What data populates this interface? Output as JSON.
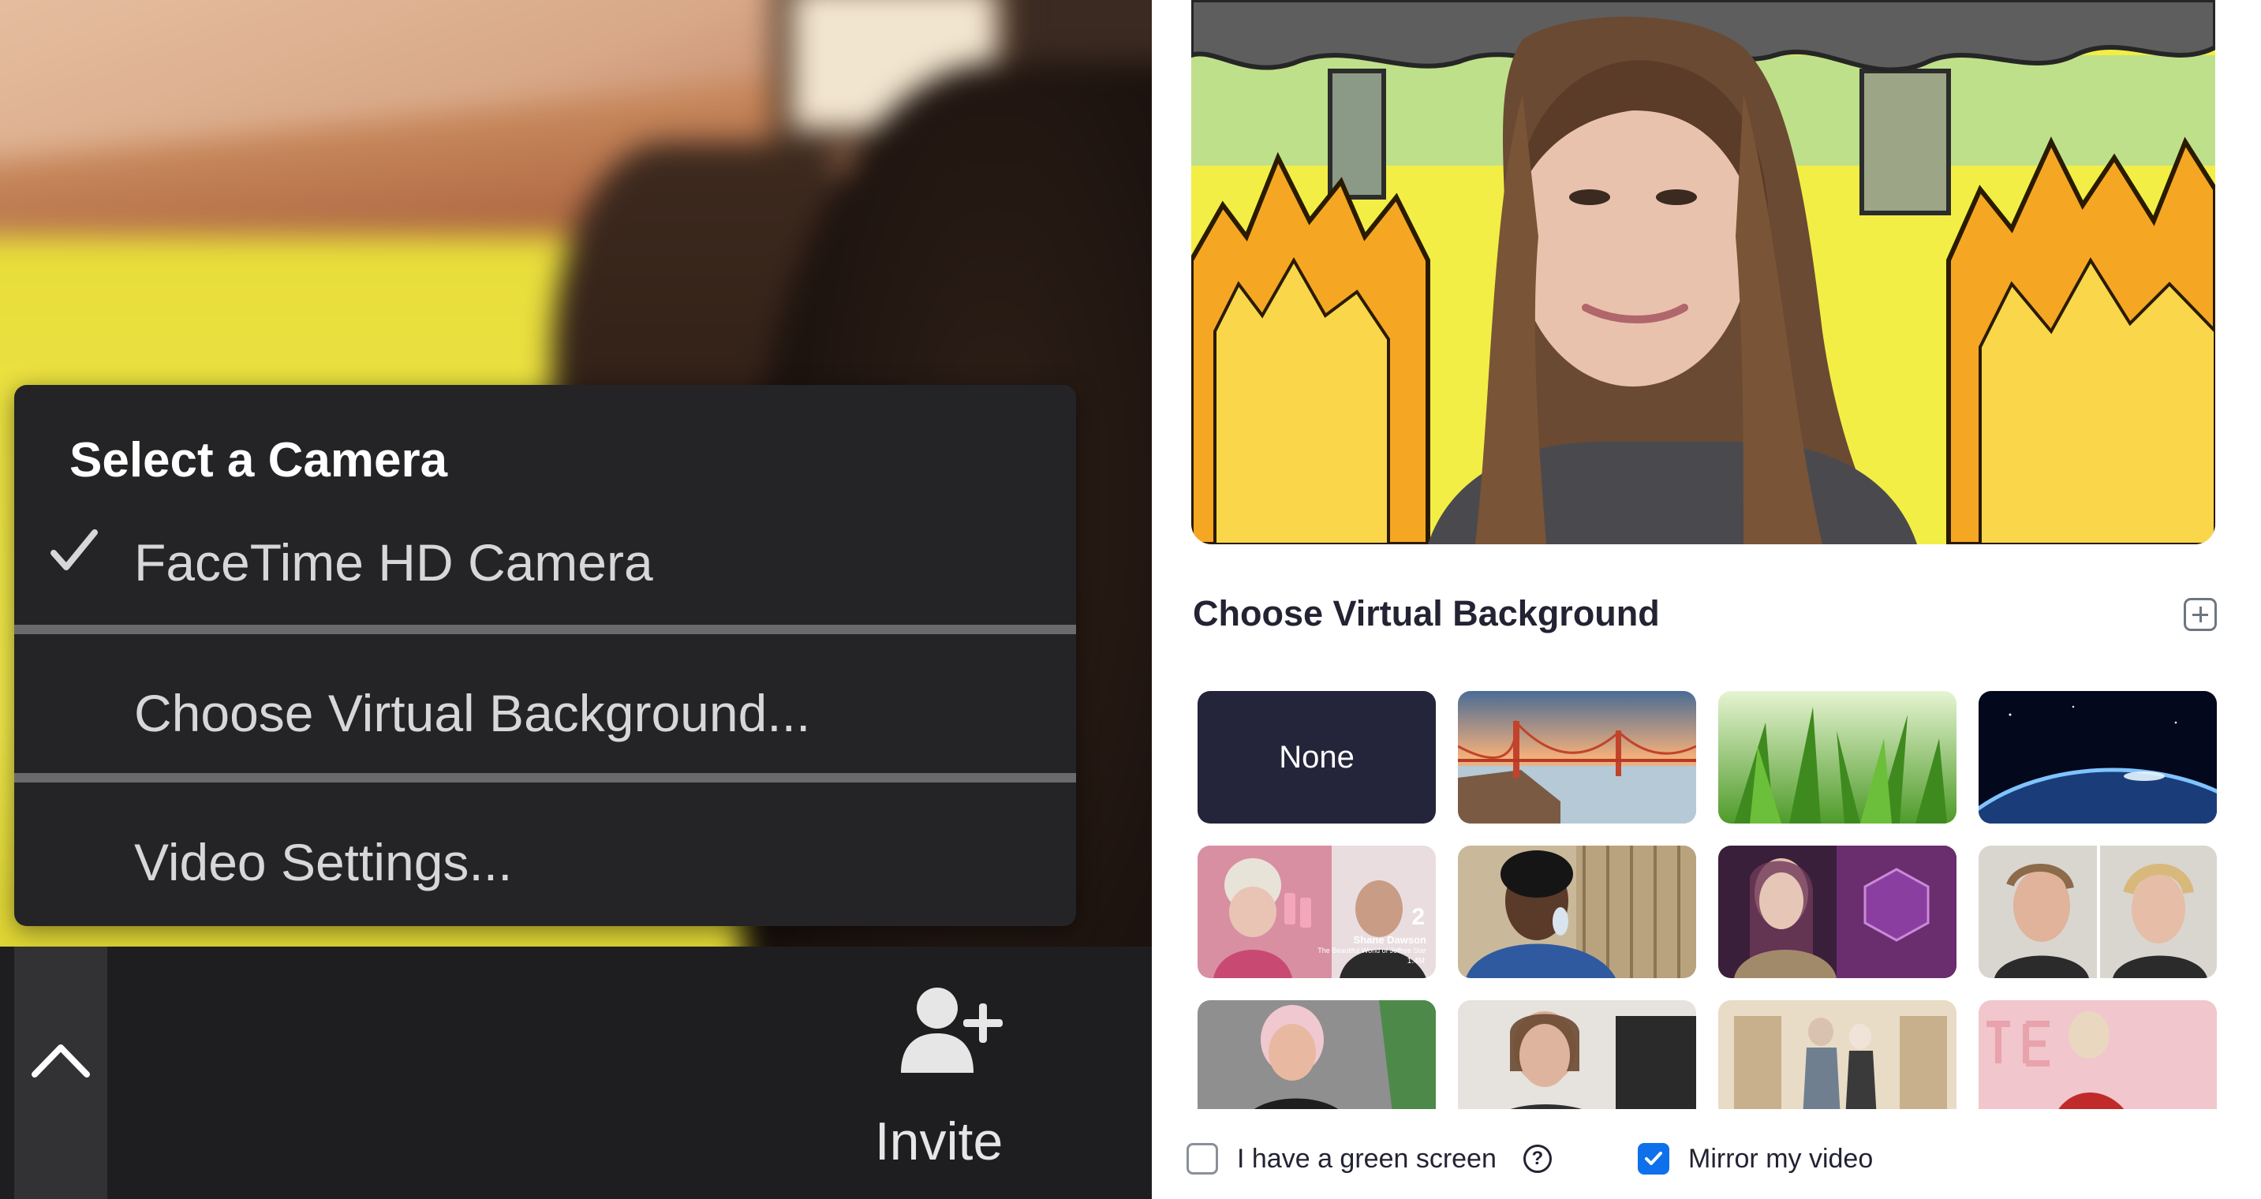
{
  "camera_menu": {
    "title": "Select a Camera",
    "items": [
      {
        "label": "FaceTime HD Camera",
        "checked": true
      },
      {
        "label": "Choose Virtual Background..."
      },
      {
        "label": "Video Settings..."
      }
    ]
  },
  "toolbar": {
    "invite_label": "Invite"
  },
  "virtual_background": {
    "title": "Choose Virtual Background",
    "none_label": "None",
    "thumbnail_text": {
      "episode_number": "2",
      "channel": "Shane Dawson",
      "video_title": "The Beautiful World of Jeffree Star",
      "likes": "1.4M"
    },
    "green_screen_label": "I have a green screen",
    "green_screen_checked": false,
    "mirror_label": "Mirror my video",
    "mirror_checked": true
  },
  "colors": {
    "accent": "#0e71eb",
    "menu_bg": "#242426",
    "none_tile": "#24243a"
  },
  "icons": [
    "checkmark-icon",
    "chevron-up-icon",
    "add-person-icon",
    "add-background-icon",
    "help-icon",
    "checkbox-check-icon"
  ]
}
